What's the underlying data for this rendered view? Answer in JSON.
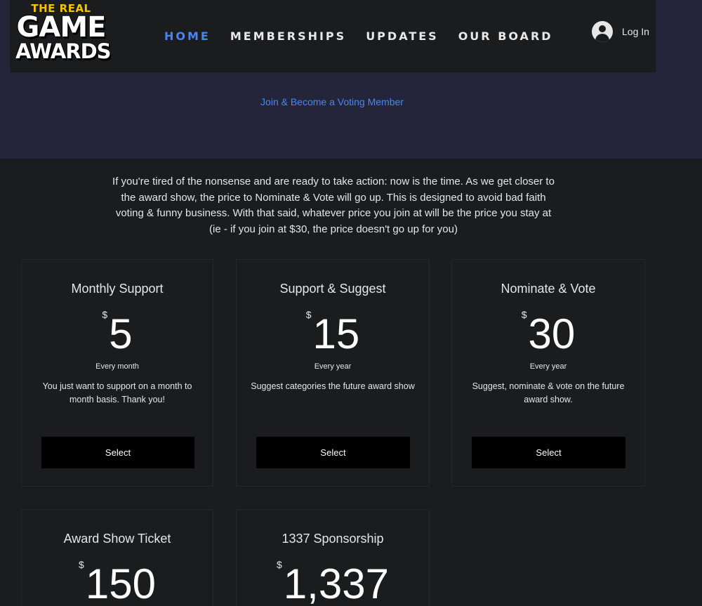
{
  "logo": {
    "line1": "THE REAL",
    "line2": "GAME",
    "line3": "AWARDS"
  },
  "nav": {
    "items": [
      {
        "label": "HOME",
        "active": true
      },
      {
        "label": "MEMBERSHIPS",
        "active": false
      },
      {
        "label": "UPDATES",
        "active": false
      },
      {
        "label": "OUR BOARD",
        "active": false
      }
    ]
  },
  "login": {
    "label": "Log In",
    "icon": "user-avatar-icon"
  },
  "banner": {
    "join_link": "Join & Become a Voting Member"
  },
  "intro": {
    "text": "If you're tired of the nonsense and are ready to take action: now is the time. As we get closer to the award show, the price to Nominate & Vote will go up. This is designed to avoid bad faith voting & funny business. With that said, whatever price you join at will be the price you stay at (ie - if you join at $30, the price doesn't go up for you)"
  },
  "plans": [
    {
      "title": "Monthly Support",
      "currency": "$",
      "price": "5",
      "period": "Every month",
      "description": "You just want to support on a month to month basis. Thank you!",
      "button": "Select"
    },
    {
      "title": "Support & Suggest",
      "currency": "$",
      "price": "15",
      "period": "Every year",
      "description": "Suggest categories the future award show",
      "button": "Select"
    },
    {
      "title": "Nominate & Vote",
      "currency": "$",
      "price": "30",
      "period": "Every year",
      "description": "Suggest, nominate & vote on the future award show.",
      "button": "Select"
    },
    {
      "title": "Award Show Ticket",
      "currency": "$",
      "price": "150"
    },
    {
      "title": "1337 Sponsorship",
      "currency": "$",
      "price": "1,337"
    }
  ],
  "colors": {
    "accent": "#4a86f0",
    "background": "#1b1c1e",
    "banner": "#24253a",
    "logo_yellow": "#f5c400"
  }
}
